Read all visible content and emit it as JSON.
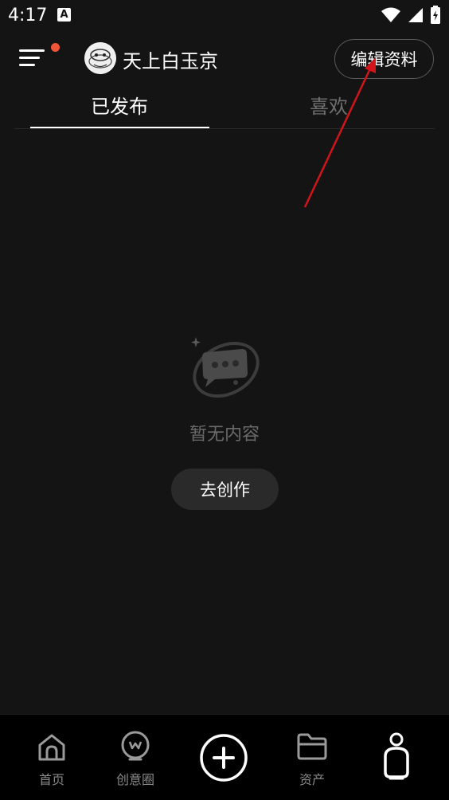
{
  "status_bar": {
    "time": "4:17",
    "app_icon_glyph": "A",
    "icons": [
      "wifi-icon",
      "signal-icon",
      "battery-icon"
    ]
  },
  "header": {
    "menu_icon": "menu-icon",
    "notification_dot_color": "#f0553a",
    "username": "天上白玉京",
    "edit_profile_label": "编辑资料"
  },
  "tabs": [
    {
      "label": "已发布",
      "active": true
    },
    {
      "label": "喜欢",
      "active": false
    }
  ],
  "empty_state": {
    "icon": "empty-chat-bubble-icon",
    "message": "暂无内容",
    "create_button_label": "去创作"
  },
  "annotation": {
    "arrow_color": "#d0141a"
  },
  "bottom_nav": {
    "items": [
      {
        "label": "首页",
        "icon": "home-icon"
      },
      {
        "label": "创意圈",
        "icon": "creative-circle-icon"
      },
      {
        "label": "",
        "icon": "add-circle-icon"
      },
      {
        "label": "资产",
        "icon": "folder-icon"
      },
      {
        "label": "",
        "icon": "profile-icon"
      }
    ]
  }
}
